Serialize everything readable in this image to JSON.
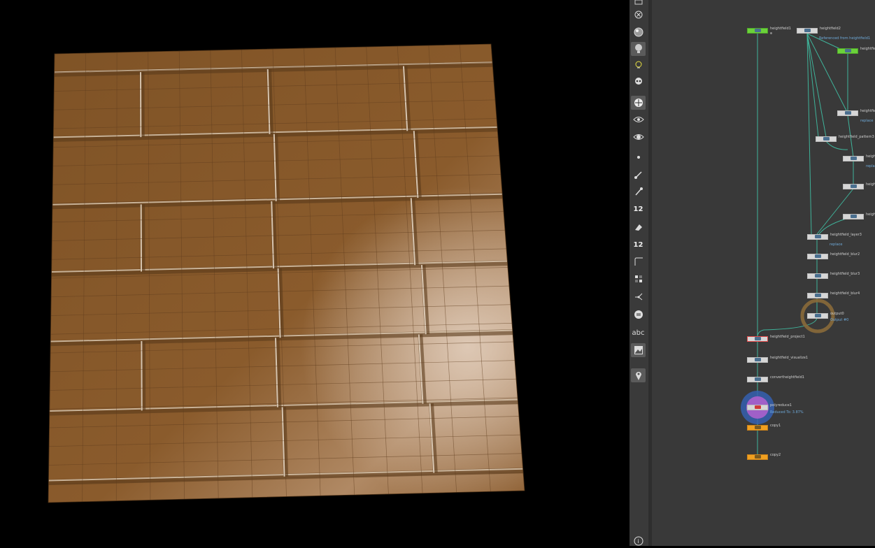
{
  "viewport": {
    "description_icon": "heightfield-mesh",
    "surface_color": "#8a5a2b"
  },
  "toolbar": {
    "tools": [
      {
        "icon": "select-icon",
        "label": ""
      },
      {
        "icon": "close-icon",
        "label": ""
      },
      {
        "icon": "sphere-icon",
        "label": ""
      },
      {
        "icon": "light-icon",
        "label": ""
      },
      {
        "icon": "bulb-icon",
        "label": ""
      },
      {
        "icon": "skull-icon",
        "label": ""
      },
      {
        "icon": "ball-icon",
        "label": ""
      },
      {
        "icon": "eye-icon",
        "label": ""
      },
      {
        "icon": "camera-icon",
        "label": ""
      },
      {
        "icon": "dot-icon",
        "label": ""
      },
      {
        "icon": "brush-icon",
        "label": ""
      },
      {
        "icon": "pen-icon",
        "label": ""
      },
      {
        "icon": "count-icon",
        "label": "12"
      },
      {
        "icon": "eraser-icon",
        "label": ""
      },
      {
        "icon": "count-icon-2",
        "label": "12"
      },
      {
        "icon": "corner-icon",
        "label": ""
      },
      {
        "icon": "grid-icon",
        "label": ""
      },
      {
        "icon": "branch-icon",
        "label": ""
      },
      {
        "icon": "list-icon",
        "label": ""
      },
      {
        "icon": "text-icon",
        "label": "abc"
      },
      {
        "icon": "image-icon",
        "label": ""
      },
      {
        "icon": "pin-icon",
        "label": ""
      },
      {
        "icon": "info-icon",
        "label": "i"
      }
    ]
  },
  "network": {
    "nodes": [
      {
        "name": "heightfield1",
        "sub": "",
        "style": "green"
      },
      {
        "name": "heightfield2",
        "sub": "Referenced from heightfield1",
        "style": "grey"
      },
      {
        "name": "heightfie",
        "sub": "",
        "style": "green"
      },
      {
        "name": "heightfie",
        "sub": "replace",
        "style": "grey"
      },
      {
        "name": "heightfield_pattern3",
        "sub": "",
        "style": "grey"
      },
      {
        "name": "heightf",
        "sub": "replac",
        "style": "grey"
      },
      {
        "name": "heightf",
        "sub": "",
        "style": "grey"
      },
      {
        "name": "heightf",
        "sub": "",
        "style": "grey"
      },
      {
        "name": "heightfield_layer3",
        "sub": "replace",
        "style": "grey"
      },
      {
        "name": "heightfield_blur2",
        "sub": "",
        "style": "grey"
      },
      {
        "name": "heightfield_blur3",
        "sub": "",
        "style": "grey"
      },
      {
        "name": "heightfield_blur4",
        "sub": "",
        "style": "grey"
      },
      {
        "name": "output0",
        "sub": "Output #0",
        "style": "grey"
      },
      {
        "name": "heightfield_project1",
        "sub": "",
        "style": "grey"
      },
      {
        "name": "heightfield_visualize1",
        "sub": "",
        "style": "grey"
      },
      {
        "name": "convertheightfield1",
        "sub": "",
        "style": "grey"
      },
      {
        "name": "polyreduce1",
        "sub": "Reduced To: 3.87%",
        "style": "grey"
      },
      {
        "name": "copy1",
        "sub": "",
        "style": "orange"
      },
      {
        "name": "copy2",
        "sub": "",
        "style": "orange"
      }
    ]
  },
  "colors": {
    "wire": "#3fb39a",
    "background": "#393939",
    "toolbar": "#3a3a3a"
  }
}
